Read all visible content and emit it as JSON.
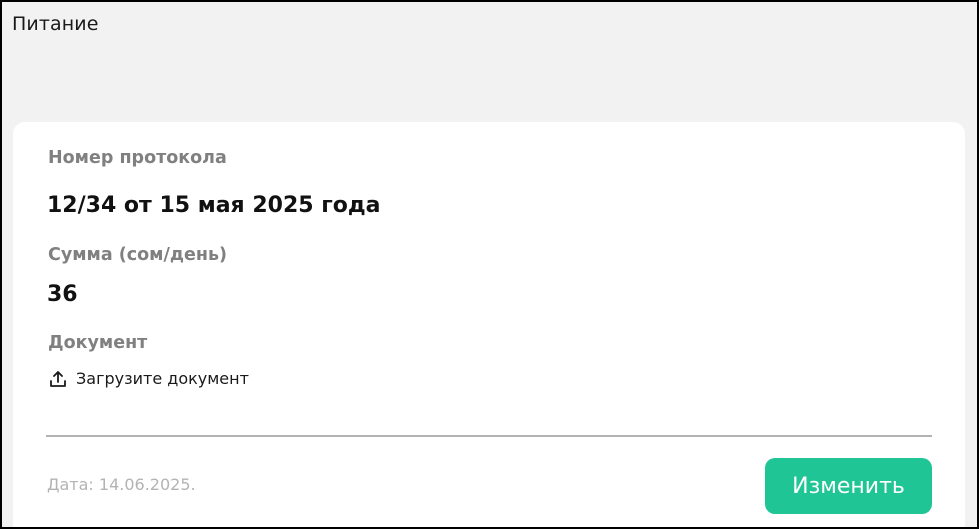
{
  "section": {
    "title": "Питание"
  },
  "card": {
    "protocol": {
      "label": "Номер протокола",
      "value": "12/34 от 15 мая 2025 года"
    },
    "sum": {
      "label": "Сумма (сом/день)",
      "value": "36"
    },
    "document": {
      "label": "Документ",
      "upload_label": "Загрузите документ",
      "upload_icon": "upload-icon"
    },
    "footer": {
      "date": "Дата: 14.06.2025.",
      "edit_label": "Изменить"
    }
  },
  "colors": {
    "accent": "#1fc594",
    "label": "#808080",
    "muted": "#b3b3b3",
    "background": "#f2f2f2"
  }
}
